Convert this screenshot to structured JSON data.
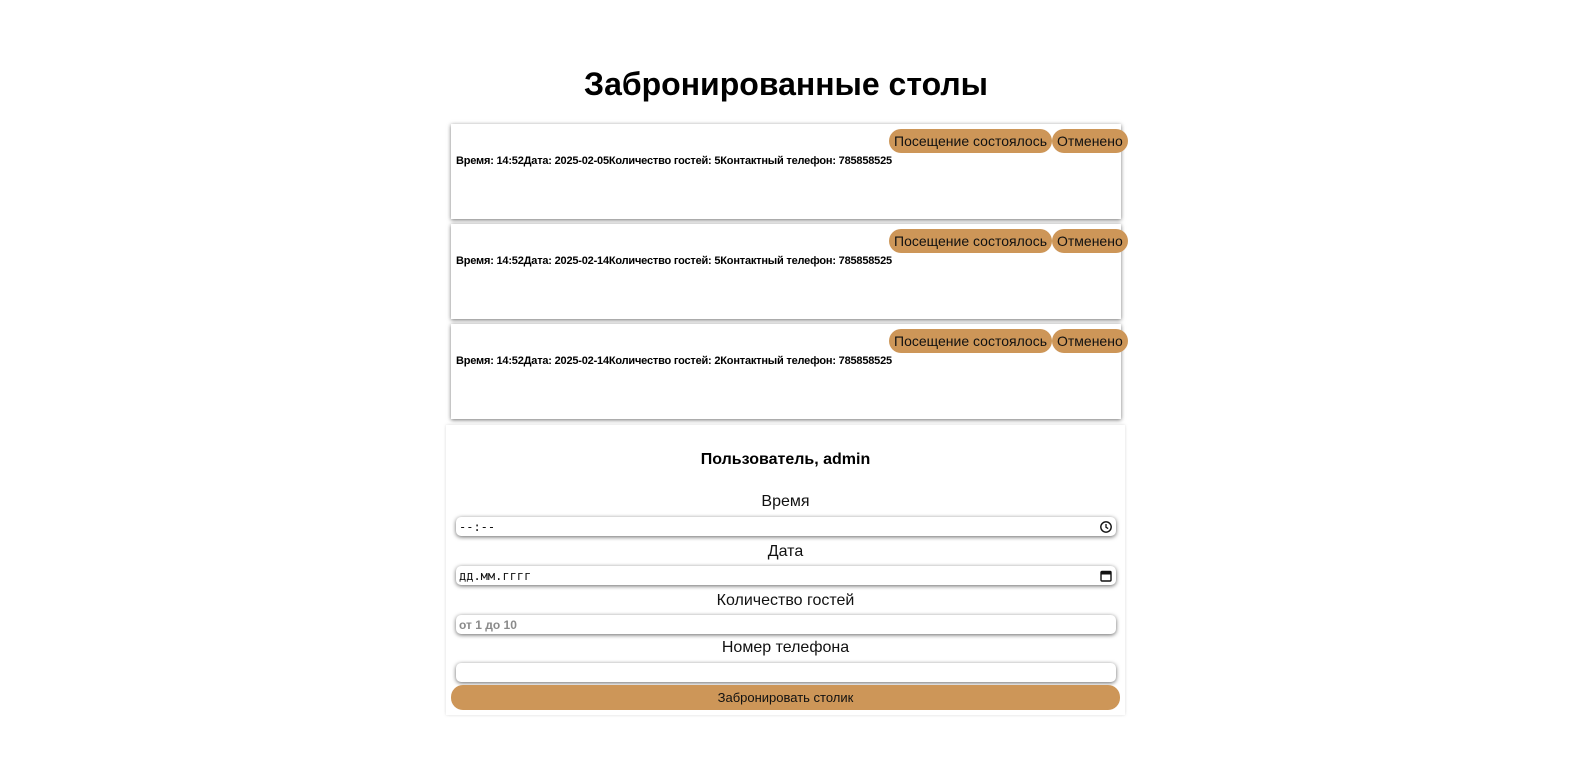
{
  "page": {
    "title": "Забронированные столы"
  },
  "bookings": [
    {
      "info": "Время: 14:52Дата: 2025-02-05Количество гостей: 5Контактный телефон: 785858525",
      "visited_label": "Посещение состоялось",
      "cancel_label": "Отменено"
    },
    {
      "info": "Время: 14:52Дата: 2025-02-14Количество гостей: 5Контактный телефон: 785858525",
      "visited_label": "Посещение состоялось",
      "cancel_label": "Отменено"
    },
    {
      "info": "Время: 14:52Дата: 2025-02-14Количество гостей: 2Контактный телефон: 785858525",
      "visited_label": "Посещение состоялось",
      "cancel_label": "Отменено"
    }
  ],
  "form": {
    "user_greeting": "Пользователь, admin",
    "time": {
      "label": "Время",
      "value": "--:--",
      "icon": "clock-icon"
    },
    "date": {
      "label": "Дата",
      "value": "дд.мм.гггг",
      "icon": "calendar-icon"
    },
    "guests": {
      "label": "Количество гостей",
      "placeholder": "от 1 до 10"
    },
    "phone": {
      "label": "Номер телефона",
      "value": ""
    },
    "submit_label": "Забронировать столик"
  },
  "colors": {
    "accent": "#cd9658",
    "background": "#ffffff"
  }
}
